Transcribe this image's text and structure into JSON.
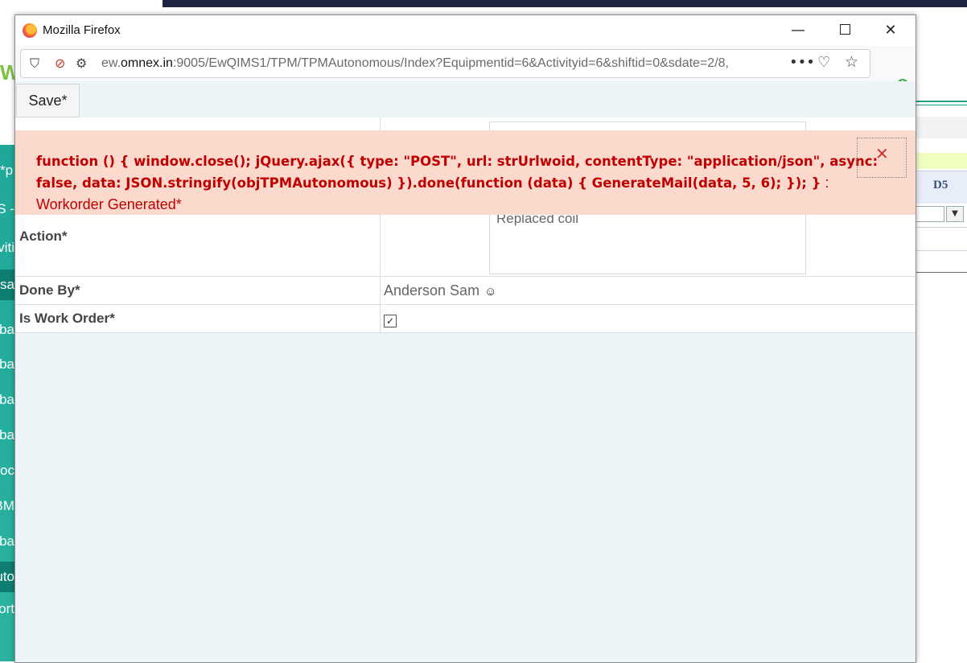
{
  "window": {
    "title": "Mozilla Firefox",
    "controls": {
      "minimize": "—",
      "maximize": "",
      "close": "✕"
    }
  },
  "addressbar": {
    "url_prefix": "ew.",
    "url_domain": "omnex.in",
    "url_rest": ":9005/EwQIMS1/TPM/TPMAutonomous/Index?Equipmentid=6&Activityid=6&shiftid=0&sdate=2/8,",
    "more": "•••"
  },
  "toolbar": {
    "save_label": "Save*"
  },
  "form": {
    "action_label": "Action*",
    "action_value": "Replaced coil",
    "done_by_label": "Done By*",
    "done_by_value": "Anderson Sam",
    "work_order_label": "Is Work Order*",
    "work_order_checked": "✓"
  },
  "alert": {
    "code": "function () { window.close(); jQuery.ajax({ type: \"POST\", url: strUrlwoid, contentType: \"application/json\", async: false, data: JSON.stringify(objTPMAutonomous) }).done(function (data) { GenerateMail(data, 5, 6); }); }",
    "message": " : Workorder Generated*",
    "close": "✕"
  },
  "background": {
    "logo_letter": "W",
    "column_header": "D5",
    "sidebar_fragments": [
      "p*",
      "- S",
      "viti",
      "sa",
      "ba",
      "ba",
      "ba",
      "ba",
      "roc",
      "BM",
      "ba",
      "uto",
      "ort"
    ]
  }
}
